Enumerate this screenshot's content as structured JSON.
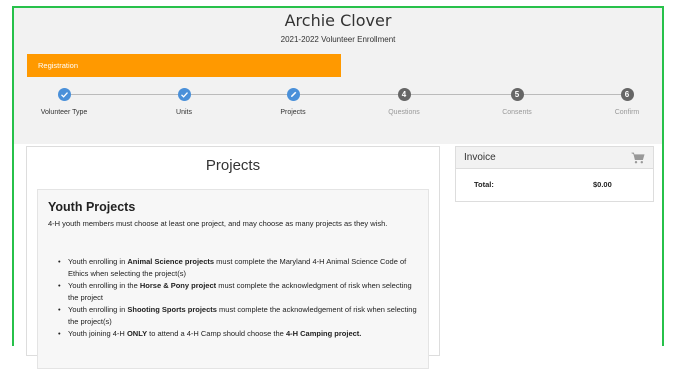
{
  "header": {
    "title": "Archie Clover",
    "subtitle": "2021-2022 Volunteer Enrollment"
  },
  "registration_bar": {
    "label": "Registration",
    "color": "#ff9900"
  },
  "steps": [
    {
      "label": "Volunteer Type",
      "number": "",
      "done": true,
      "icon": "check-icon"
    },
    {
      "label": "Units",
      "number": "",
      "done": true,
      "icon": "check-icon"
    },
    {
      "label": "Projects",
      "number": "",
      "done": true,
      "icon": "pencil-icon"
    },
    {
      "label": "Questions",
      "number": "4",
      "done": false
    },
    {
      "label": "Consents",
      "number": "5",
      "done": false
    },
    {
      "label": "Confirm",
      "number": "6",
      "done": false
    }
  ],
  "projects": {
    "heading": "Projects",
    "youth_title": "Youth Projects",
    "intro": "4-H youth members must choose at least one project, and may choose as many projects as they wish.",
    "bullets": [
      {
        "pre": "Youth enrolling in ",
        "bold": "Animal Science projects",
        "post": " must complete the Maryland 4-H Animal Science Code of Ethics when selecting the project(s)"
      },
      {
        "pre": "Youth enrolling in the ",
        "bold": "Horse & Pony project",
        "post": " must complete the acknowledgment of risk when selecting the project"
      },
      {
        "pre": "Youth enrolling in ",
        "bold": "Shooting Sports projects",
        "post": " must complete the acknowledgement of risk when selecting the project(s)"
      },
      {
        "pre": "Youth joining 4-H ",
        "bold": "ONLY",
        "post": " to attend a 4-H Camp should choose the ",
        "bold2": "4-H Camping project."
      }
    ]
  },
  "invoice": {
    "title": "Invoice",
    "total_label": "Total:",
    "total_value": "$0.00",
    "icon": "cart-icon"
  },
  "colors": {
    "accent": "#4a90d9",
    "frame": "#27c14a",
    "registration": "#ff9900"
  }
}
